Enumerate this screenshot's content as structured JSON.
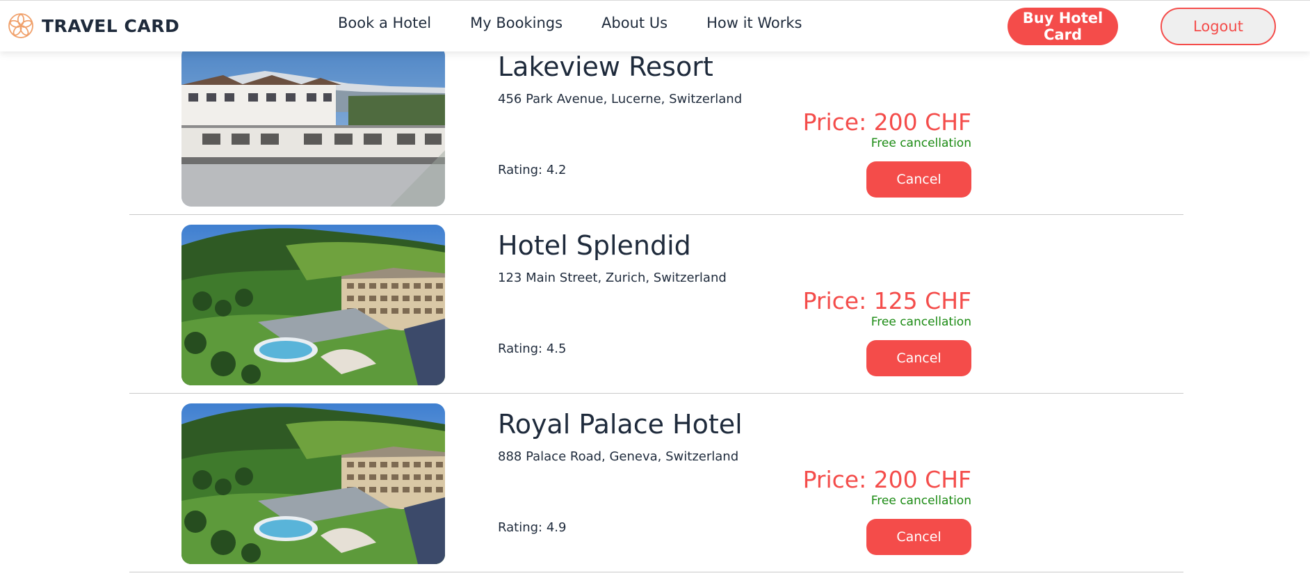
{
  "header": {
    "brand": "TRAVEL CARD",
    "brand_icon": "flower-logo-icon",
    "nav": [
      "Book a Hotel",
      "My Bookings",
      "About Us",
      "How it Works"
    ],
    "buy_button": "Buy Hotel Card",
    "logout_button": "Logout"
  },
  "colors": {
    "accent": "#f44c4a",
    "text": "#1e2a3b",
    "success": "#1a8a12"
  },
  "bookings": [
    {
      "name": "Lakeview Resort",
      "address": "456 Park Avenue, Lucerne, Switzerland",
      "rating": "Rating: 4.2",
      "price": "Price: 200 CHF",
      "cancellation": "Free cancellation",
      "cancel_label": "Cancel",
      "image": "alpine-village-hotel-photo"
    },
    {
      "name": "Hotel Splendid",
      "address": "123 Main Street, Zurich, Switzerland",
      "rating": "Rating: 4.5",
      "price": "Price: 125 CHF",
      "cancellation": "Free cancellation",
      "cancel_label": "Cancel",
      "image": "mountain-resort-pool-photo"
    },
    {
      "name": "Royal Palace Hotel",
      "address": "888 Palace Road, Geneva, Switzerland",
      "rating": "Rating: 4.9",
      "price": "Price: 200 CHF",
      "cancellation": "Free cancellation",
      "cancel_label": "Cancel",
      "image": "mountain-resort-pool-photo"
    }
  ]
}
